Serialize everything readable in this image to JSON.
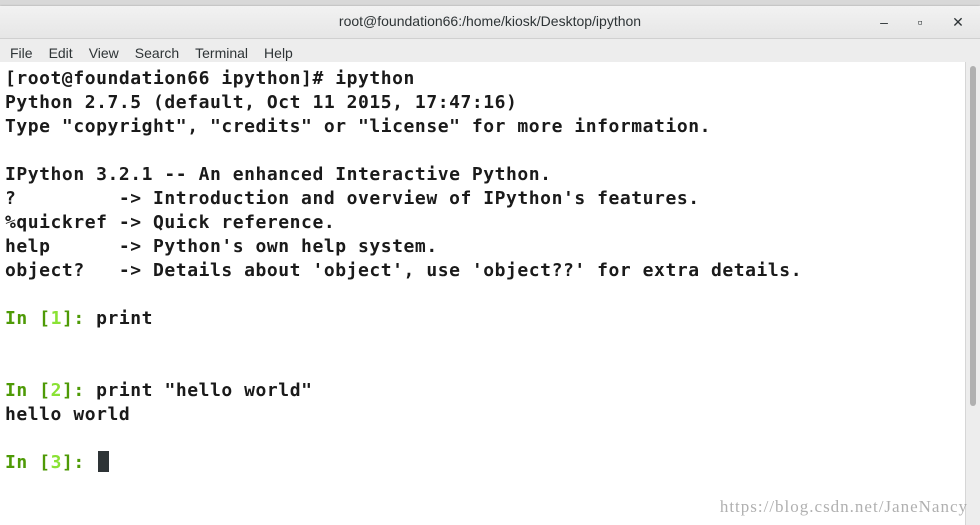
{
  "window": {
    "title": "root@foundation66:/home/kiosk/Desktop/ipython",
    "minimize_icon": "‒",
    "maximize_icon": "▫",
    "close_icon": "✕"
  },
  "menu": [
    "File",
    "Edit",
    "View",
    "Search",
    "Terminal",
    "Help"
  ],
  "terminal": {
    "lines": [
      "[root@foundation66 ipython]# ipython",
      "Python 2.7.5 (default, Oct 11 2015, 17:47:16)",
      "Type \"copyright\", \"credits\" or \"license\" for more information.",
      "",
      "IPython 3.2.1 -- An enhanced Interactive Python.",
      "?         -> Introduction and overview of IPython's features.",
      "%quickref -> Quick reference.",
      "help      -> Python's own help system.",
      "object?   -> Details about 'object', use 'object??' for extra details."
    ],
    "cells": [
      {
        "prompt_in": "In [",
        "num": "1",
        "prompt_close": "]:",
        "input": " print",
        "output": ""
      },
      {
        "prompt_in": "In [",
        "num": "2",
        "prompt_close": "]:",
        "input": " print \"hello world\"",
        "output": "hello world"
      }
    ],
    "current": {
      "prompt_in": "In [",
      "num": "3",
      "prompt_close": "]:",
      "input": " "
    }
  },
  "watermark": "https://blog.csdn.net/JaneNancy",
  "colors": {
    "prompt": "#4e9a06",
    "prompt_number": "#8ae234",
    "text": "#1a1a1a"
  }
}
